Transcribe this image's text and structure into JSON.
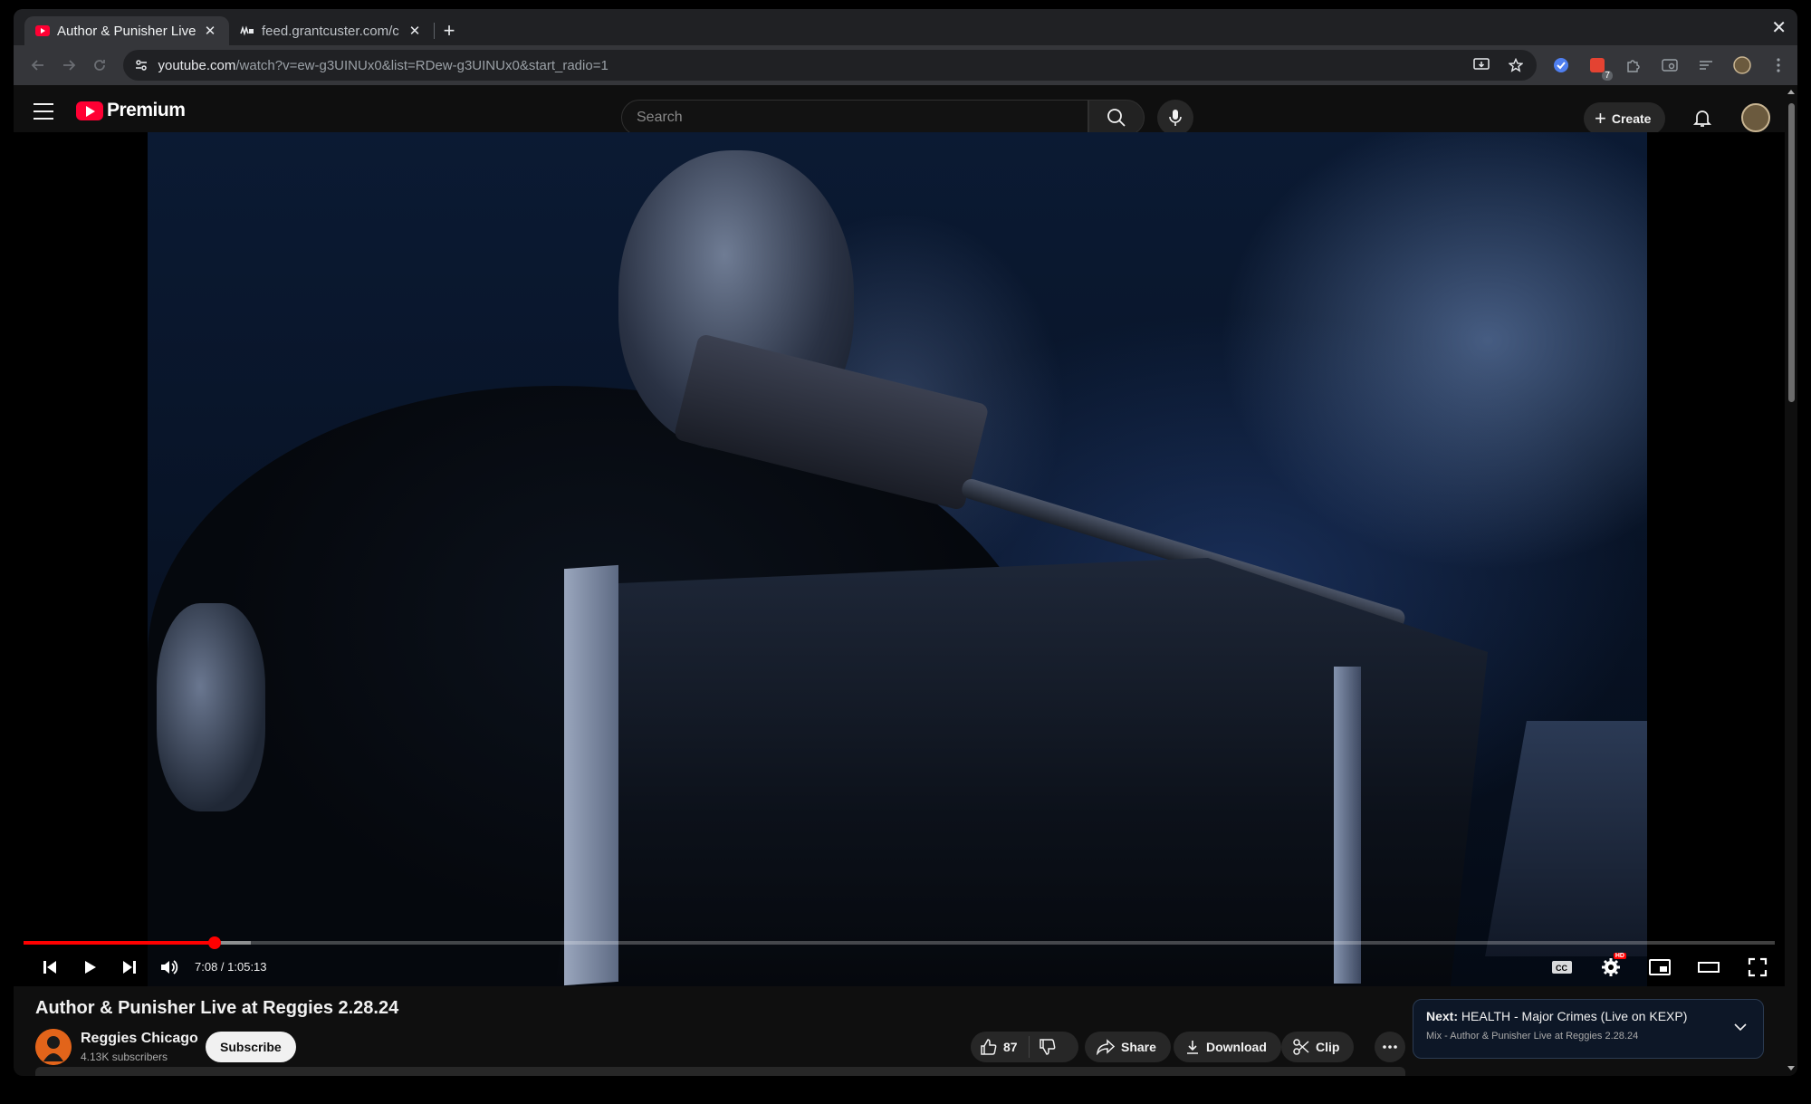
{
  "browser": {
    "tabs": [
      {
        "title": "Author & Punisher Live",
        "active": true,
        "favicon": "youtube-icon"
      },
      {
        "title": "feed.grantcuster.com/c",
        "active": false,
        "favicon": "grantcuster-icon"
      }
    ],
    "new_tab_symbol": "+",
    "close_symbol": "✕",
    "url_host": "youtube.com",
    "url_rest": "/watch?v=ew-g3UINUx0&list=RDew-g3UINUx0&start_radio=1",
    "extension_badge": "7"
  },
  "masthead": {
    "logo_text": "Premium",
    "search_placeholder": "Search",
    "create_label": "Create"
  },
  "player": {
    "current_time": "7:08",
    "duration": "1:05:13",
    "time_display": "7:08 / 1:05:13",
    "played_fraction": 0.109,
    "buffered_fraction": 0.13,
    "settings_badge": "HD"
  },
  "video": {
    "title": "Author & Punisher Live at Reggies 2.28.24",
    "channel_name": "Reggies Chicago",
    "subscribers": "4.13K subscribers",
    "subscribe_label": "Subscribe",
    "like_count": "87",
    "share_label": "Share",
    "download_label": "Download",
    "clip_label": "Clip"
  },
  "up_next": {
    "prefix": "Next:",
    "title": "HEALTH - Major Crimes (Live on KEXP)",
    "mix_label": "Mix - Author & Punisher Live at Reggies 2.28.24"
  },
  "colors": {
    "brand_red": "#ff0000",
    "page_bg": "#0f0f0f"
  }
}
